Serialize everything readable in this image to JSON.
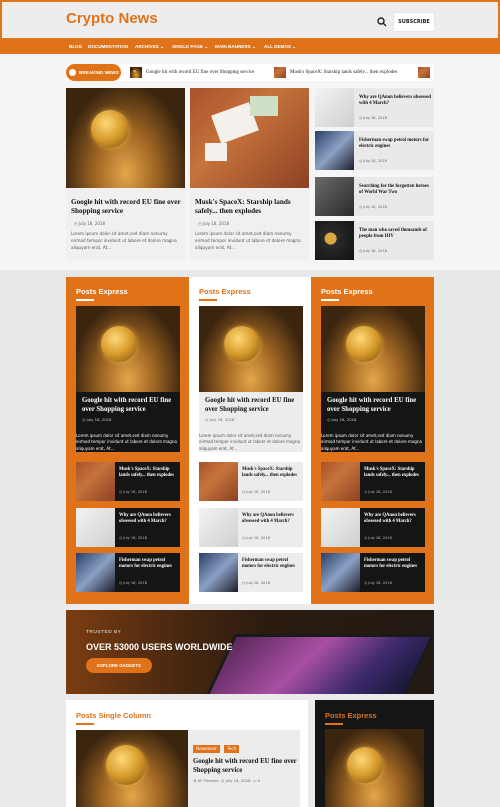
{
  "site": {
    "title": "Crypto News",
    "subscribe_label": "SUBSCRIBE"
  },
  "nav": {
    "items": [
      "BLOG",
      "DOCUMENTATION",
      "ARCHIVES",
      "SINGLE PAGE",
      "MAIN BANNERS",
      "ALL DEMOS"
    ],
    "dropdown_flags": [
      false,
      false,
      true,
      true,
      true,
      true
    ]
  },
  "breaking": {
    "label": "BREAKING NEWS",
    "items": [
      "Google hit with record EU fine over Shopping service",
      "Musk's SpaceX: Starship lands safely... then explodes"
    ]
  },
  "hero": [
    {
      "title": "Google hit with record EU fine over Shopping service",
      "date": "July 18, 2018",
      "excerpt": "Lorem ipsum dolor sit amet,sed diam nonumy eirmod tempor invidunt ut labore et dolore magna aliquyam erat, At..."
    },
    {
      "title": "Musk's SpaceX: Starship lands safely... then explodes",
      "date": "July 18, 2018",
      "excerpt": "Lorem ipsum dolor sit amet,sed diam nonumy eirmod tempor invidunt ut labore et dolore magna aliquyam erat, At..."
    }
  ],
  "sidebar": [
    {
      "title": "Why are QAnon believers obsessed with 4 March?",
      "date": "July 18, 2018"
    },
    {
      "title": "Fisherman swap petrol motors for electric engines",
      "date": "July 18, 2018"
    },
    {
      "title": "Searching for the forgotten heroes of World War Two",
      "date": "July 18, 2018"
    },
    {
      "title": "The man who saved thousands of people from HIV",
      "date": "July 18, 2018"
    }
  ],
  "posts_express": {
    "heading": "Posts Express",
    "main": {
      "title": "Google hit with record EU fine over Shopping service",
      "date": "July 18, 2018",
      "excerpt": "Lorem ipsum dolor sit amet,sed diam nonumy eirmod tempor invidunt ut labore et dolore magna aliquyam erat, At..."
    },
    "rows": [
      {
        "title": "Musk's SpaceX: Starship lands safely... then explodes",
        "date": "July 18, 2018"
      },
      {
        "title": "Why are QAnon believers obsessed with 4 March?",
        "date": "July 18, 2018"
      },
      {
        "title": "Fisherman swap petrol motors for electric engines",
        "date": "July 18, 2018"
      }
    ]
  },
  "banner": {
    "trusted": "TRUSTED BY",
    "headline": "OVER 53000 USERS WORLDWIDE",
    "button": "EXPLORE GADGETS"
  },
  "single_column": {
    "heading": "Posts Single Column",
    "tags": [
      "Newsbeat",
      "Tech"
    ],
    "title": "Google hit with record EU fine over Shopping service",
    "author": "AF Themes",
    "date": "July 18, 2018",
    "comments": "0"
  },
  "colors": {
    "accent": "#e0721a",
    "dark": "#151515"
  }
}
